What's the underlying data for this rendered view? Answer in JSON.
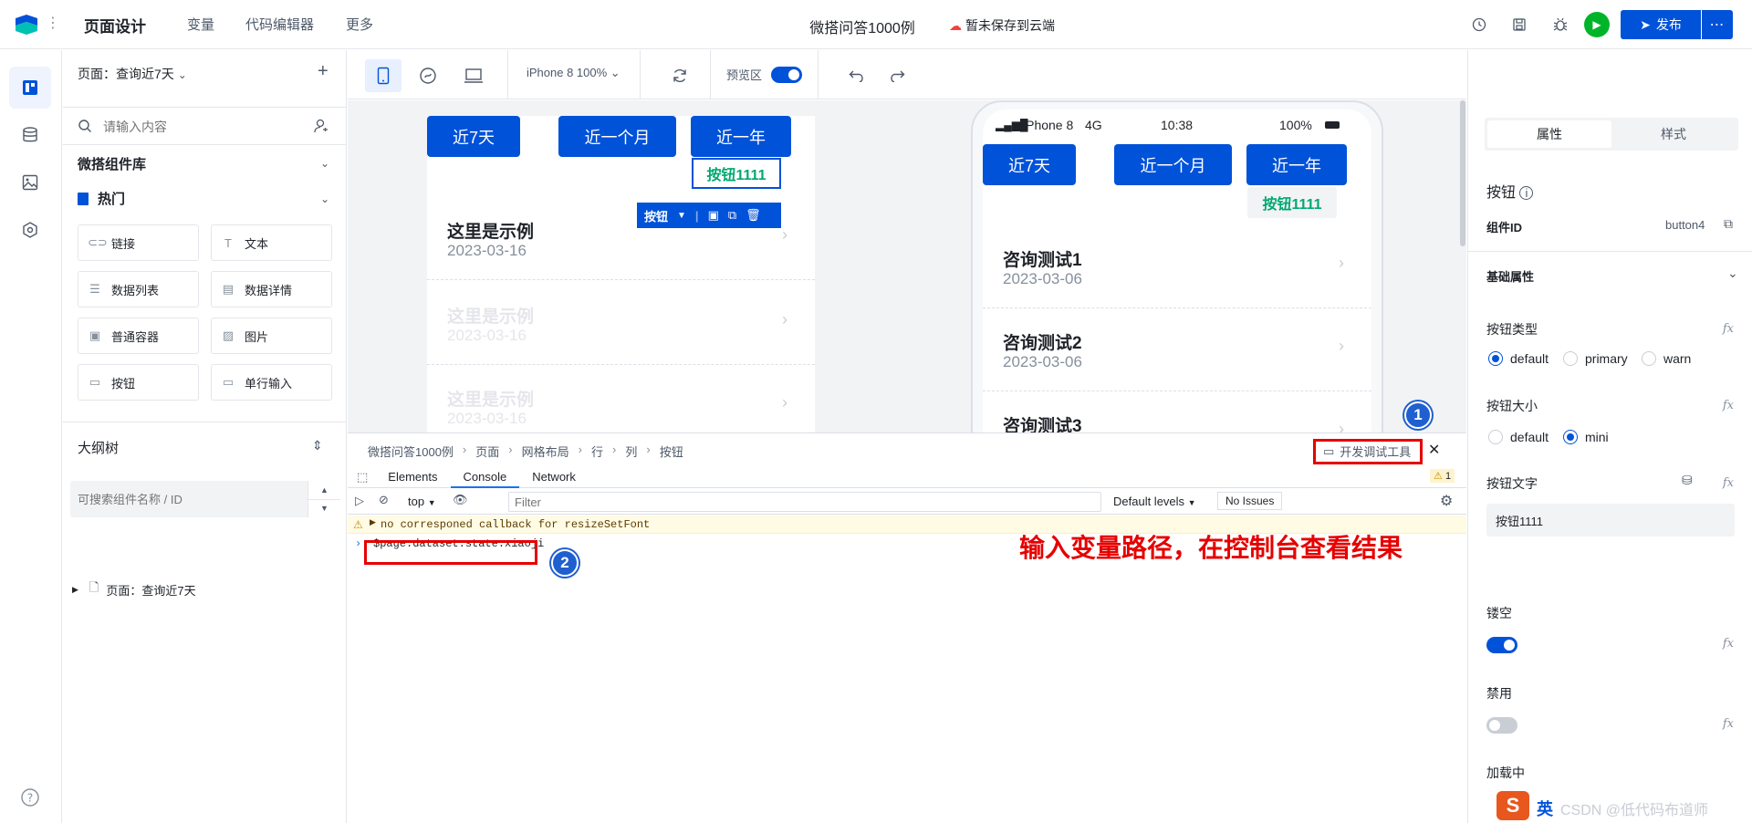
{
  "topbar": {
    "nav": [
      "页面设计",
      "变量",
      "代码编辑器",
      "更多"
    ],
    "app_title": "微搭问答1000例",
    "cloud_status": "暂未保存到云端",
    "publish_label": "发布"
  },
  "left_panel": {
    "page_select": "页面：查询近7天",
    "search_placeholder": "请输入内容",
    "library_title": "微搭组件库",
    "hot_title": "热门",
    "components": [
      {
        "label": "链接",
        "icon": "link-icon"
      },
      {
        "label": "文本",
        "icon": "text-icon"
      },
      {
        "label": "数据列表",
        "icon": "data-list-icon"
      },
      {
        "label": "数据详情",
        "icon": "data-detail-icon"
      },
      {
        "label": "普通容器",
        "icon": "container-icon"
      },
      {
        "label": "图片",
        "icon": "image-icon"
      },
      {
        "label": "按钮",
        "icon": "button-icon"
      },
      {
        "label": "单行输入",
        "icon": "input-icon"
      }
    ],
    "outline_title": "大纲树",
    "outline_placeholder": "可搜索组件名称 / ID",
    "tree_node": "页面：查询近7天"
  },
  "canvas_toolbar": {
    "device": "iPhone 8 100%",
    "preview_label": "预览区",
    "preview_on": true
  },
  "editor_frame": {
    "buttons": [
      "近7天",
      "近一个月",
      "近一年"
    ],
    "green_button": "按钮1111",
    "selection_label": "按钮",
    "items": [
      {
        "title": "这里是示例",
        "date": "2023-03-16"
      },
      {
        "title": "这里是示例",
        "date": "2023-03-16"
      },
      {
        "title": "这里是示例",
        "date": "2023-03-16"
      }
    ]
  },
  "phone_preview": {
    "status": {
      "carrier": "iPhone 8",
      "network": "4G",
      "time": "10:38",
      "battery": "100%"
    },
    "buttons": [
      "近7天",
      "近一个月",
      "近一年"
    ],
    "green_button": "按钮1111",
    "items": [
      {
        "title": "咨询测试1",
        "date": "2023-03-06"
      },
      {
        "title": "咨询测试2",
        "date": "2023-03-06"
      },
      {
        "title": "咨询测试3",
        "date": ""
      }
    ]
  },
  "devtools": {
    "breadcrumb": [
      "微搭问答1000例",
      "页面",
      "网格布局",
      "行",
      "列",
      "按钮"
    ],
    "open_label": "开发调试工具",
    "tabs": [
      "Elements",
      "Console",
      "Network"
    ],
    "active_tab": "Console",
    "warn_count": "1",
    "context": "top",
    "filter_placeholder": "Filter",
    "levels": "Default levels",
    "issues": "No Issues",
    "warning_message": "no corresponed callback for resizeSetFont",
    "console_input": "$page.dataset.state.xiaoji",
    "annotation": "输入变量路径，在控制台查看结果",
    "badge1": "1",
    "badge2": "2"
  },
  "right_panel": {
    "tabs": [
      "属性",
      "样式"
    ],
    "component_name": "按钮",
    "component_id_label": "组件ID",
    "component_id": "button4",
    "basic_props": "基础属性",
    "button_type_label": "按钮类型",
    "button_type_options": [
      "default",
      "primary",
      "warn"
    ],
    "button_type_selected": "default",
    "button_size_label": "按钮大小",
    "button_size_options": [
      "default",
      "mini"
    ],
    "button_size_selected": "mini",
    "button_text_label": "按钮文字",
    "button_text_value": "按钮1111",
    "hollow_label": "镂空",
    "hollow_on": true,
    "disabled_label": "禁用",
    "disabled_on": false,
    "loading_label": "加载中",
    "fx": "fx"
  },
  "watermark": {
    "ime": "S",
    "ime_lang": "英",
    "text": "CSDN @低代码布道师"
  },
  "colors": {
    "primary": "#0052d9",
    "success": "#00a870",
    "annotation_red": "#e60000"
  }
}
